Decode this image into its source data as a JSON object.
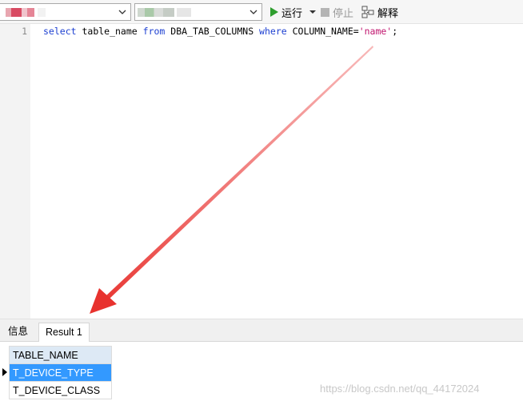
{
  "toolbar": {
    "run_label": "运行",
    "stop_label": "停止",
    "explain_label": "解释"
  },
  "editor": {
    "line_number": "1",
    "code": {
      "kw_select": "select",
      "t_table_name": " table_name ",
      "kw_from": "from",
      "t_table": " DBA_TAB_COLUMNS ",
      "kw_where": "where",
      "t_condition": " COLUMN_NAME=",
      "s_value": "'name'",
      "t_end": ";"
    }
  },
  "result_tabs": [
    {
      "label": "信息"
    },
    {
      "label": "Result 1"
    }
  ],
  "result_grid": {
    "header": "TABLE_NAME",
    "rows": [
      "T_DEVICE_TYPE",
      "T_DEVICE_CLASS"
    ]
  },
  "watermark": "https://blog.csdn.net/qq_44172024",
  "colors": {
    "keyword": "#1c3fd1",
    "string": "#c0156e",
    "run_icon": "#2e9e2e",
    "selected_row": "#3399ff",
    "arrow": "#e8322e"
  }
}
